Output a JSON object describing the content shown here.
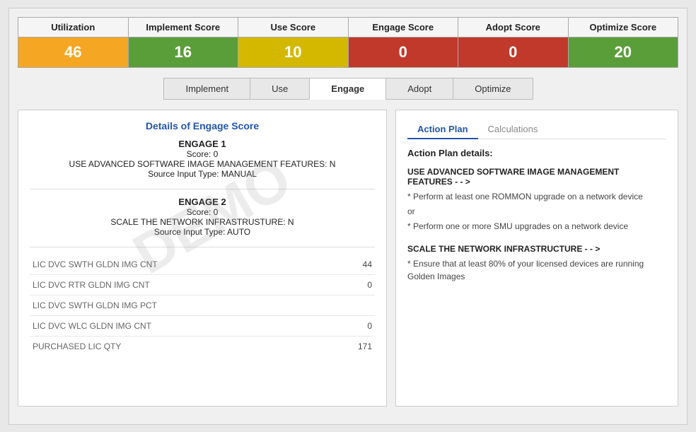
{
  "scores": {
    "utilization": {
      "label": "Utilization",
      "value": "46",
      "bg": "bg-orange"
    },
    "implement": {
      "label": "Implement Score",
      "value": "16",
      "bg": "bg-green-dark"
    },
    "use": {
      "label": "Use Score",
      "value": "10",
      "bg": "bg-yellow"
    },
    "engage": {
      "label": "Engage Score",
      "value": "0",
      "bg": "bg-red"
    },
    "adopt": {
      "label": "Adopt Score",
      "value": "0",
      "bg": "bg-red"
    },
    "optimize": {
      "label": "Optimize Score",
      "value": "20",
      "bg": "bg-green-light"
    }
  },
  "tabs": [
    {
      "label": "Implement",
      "active": false
    },
    {
      "label": "Use",
      "active": false
    },
    {
      "label": "Engage",
      "active": true
    },
    {
      "label": "Adopt",
      "active": false
    },
    {
      "label": "Optimize",
      "active": false
    }
  ],
  "left_panel": {
    "title": "Details of Engage Score",
    "engage1": {
      "title": "ENGAGE 1",
      "score": "Score: 0",
      "feature": "USE ADVANCED SOFTWARE IMAGE MANAGEMENT FEATURES: N",
      "source": "Source Input Type: MANUAL"
    },
    "engage2": {
      "title": "ENGAGE 2",
      "score": "Score: 0",
      "feature": "SCALE THE NETWORK INFRASTRUSTURE: N",
      "source": "Source Input Type: AUTO"
    },
    "data_rows": [
      {
        "key": "LIC DVC SWTH GLDN IMG CNT",
        "value": "44"
      },
      {
        "key": "LIC DVC RTR GLDN IMG CNT",
        "value": "0"
      },
      {
        "key": "LIC DVC SWTH GLDN IMG PCT",
        "value": ""
      },
      {
        "key": "LIC DVC WLC GLDN IMG CNT",
        "value": "0"
      },
      {
        "key": "PURCHASED LIC QTY",
        "value": "171"
      }
    ]
  },
  "right_panel": {
    "tabs": [
      {
        "label": "Action Plan",
        "active": true
      },
      {
        "label": "Calculations",
        "active": false
      }
    ],
    "action_title": "Action Plan details:",
    "actions": [
      {
        "title": "USE ADVANCED SOFTWARE IMAGE MANAGEMENT FEATURES - - >",
        "items": [
          "* Perform at least one ROMMON upgrade on a network device",
          "or",
          "* Perform one or more SMU upgrades on a network device"
        ]
      },
      {
        "title": "SCALE THE NETWORK INFRASTRUCTURE - - >",
        "items": [
          "* Ensure that at least 80% of your licensed devices are running Golden Images"
        ]
      }
    ]
  },
  "watermark": "DEMO"
}
